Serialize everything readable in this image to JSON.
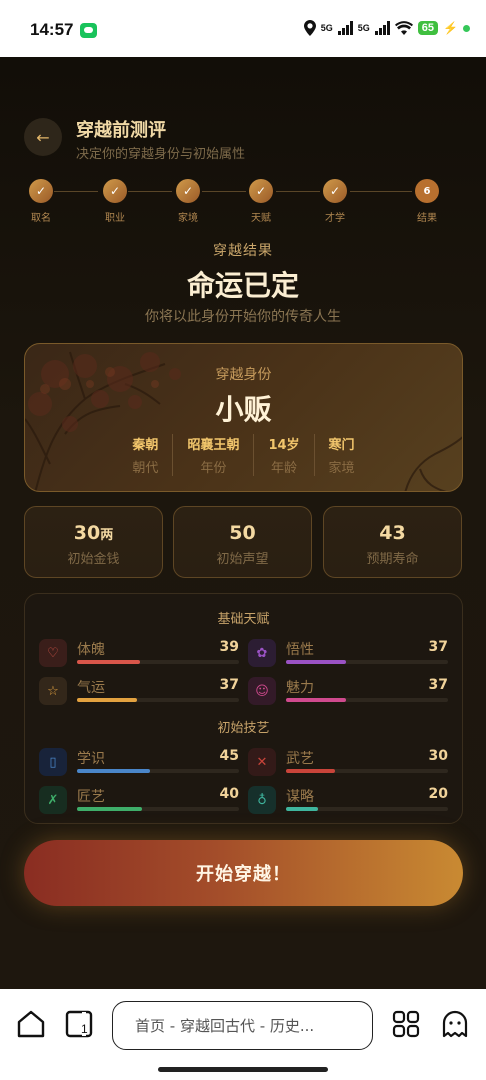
{
  "status": {
    "time": "14:57",
    "network1": "5G",
    "network2": "5G",
    "battery": "65"
  },
  "header": {
    "title": "穿越前测评",
    "subtitle": "决定你的穿越身份与初始属性"
  },
  "steps": [
    {
      "label": "取名",
      "mark": "✓"
    },
    {
      "label": "职业",
      "mark": "✓"
    },
    {
      "label": "家境",
      "mark": "✓"
    },
    {
      "label": "天赋",
      "mark": "✓"
    },
    {
      "label": "才学",
      "mark": "✓"
    },
    {
      "label": "结果",
      "mark": "6"
    }
  ],
  "result": {
    "tag": "穿越结果",
    "title": "命运已定",
    "desc": "你将以此身份开始你的传奇人生"
  },
  "identity": {
    "label": "穿越身份",
    "value": "小贩",
    "attrs": [
      {
        "value": "秦朝",
        "key": "朝代"
      },
      {
        "value": "昭襄王朝",
        "key": "年份"
      },
      {
        "value": "14岁",
        "key": "年龄"
      },
      {
        "value": "寒门",
        "key": "家境"
      }
    ]
  },
  "stats": [
    {
      "value": "30",
      "unit": "两",
      "label": "初始金钱"
    },
    {
      "value": "50",
      "unit": "",
      "label": "初始声望"
    },
    {
      "value": "43",
      "unit": "",
      "label": "预期寿命"
    }
  ],
  "talents": {
    "title": "基础天赋",
    "items": [
      {
        "name": "体魄",
        "value": "39",
        "level": 0.39,
        "color": "#d9564a",
        "icon": "heart-icon",
        "glyph": "♡",
        "bg": "#3a1e1a"
      },
      {
        "name": "悟性",
        "value": "37",
        "level": 0.37,
        "color": "#9a52c4",
        "icon": "brain-icon",
        "glyph": "✿",
        "bg": "#2c1d33"
      },
      {
        "name": "气运",
        "value": "37",
        "level": 0.37,
        "color": "#e3a240",
        "icon": "star-icon",
        "glyph": "☆",
        "bg": "#33271a"
      },
      {
        "name": "魅力",
        "value": "37",
        "level": 0.37,
        "color": "#d04a8e",
        "icon": "smile-icon",
        "glyph": "☺",
        "bg": "#331a28"
      }
    ]
  },
  "skills": {
    "title": "初始技艺",
    "items": [
      {
        "name": "学识",
        "value": "45",
        "level": 0.45,
        "color": "#4a86c9",
        "icon": "book-icon",
        "glyph": "▯",
        "bg": "#18233a"
      },
      {
        "name": "武艺",
        "value": "30",
        "level": 0.3,
        "color": "#c9443a",
        "icon": "swords-icon",
        "glyph": "✕",
        "bg": "#331a18"
      },
      {
        "name": "匠艺",
        "value": "40",
        "level": 0.4,
        "color": "#3fae6a",
        "icon": "tools-icon",
        "glyph": "✗",
        "bg": "#172d20"
      },
      {
        "name": "谋略",
        "value": "20",
        "level": 0.2,
        "color": "#3fb59e",
        "icon": "lightbulb-icon",
        "glyph": "♁",
        "bg": "#16302b"
      }
    ]
  },
  "start_button": "开始穿越！",
  "browser": {
    "url": "首页 - 穿越回古代 - 历史..."
  }
}
